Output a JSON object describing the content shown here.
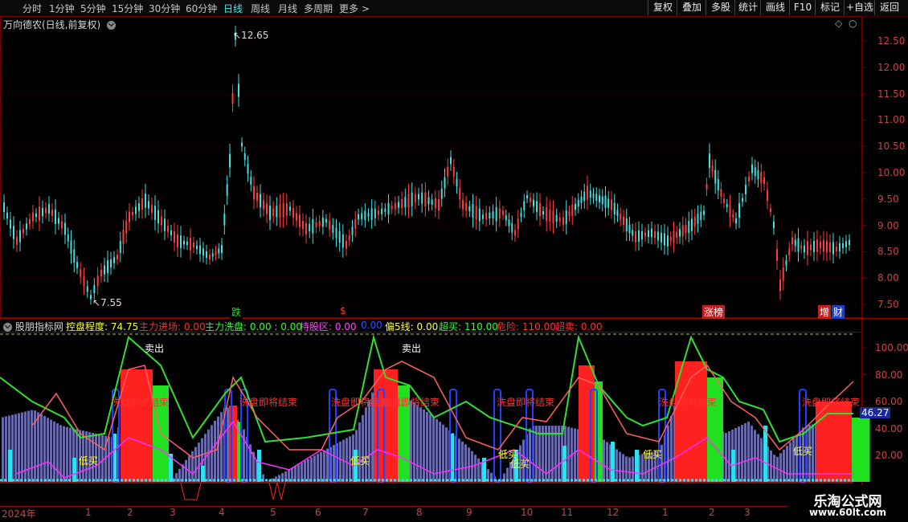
{
  "toolbar": {
    "timeframes": [
      "分时",
      "1分钟",
      "5分钟",
      "15分钟",
      "30分钟",
      "60分钟",
      "日线",
      "周线",
      "月线",
      "多周期",
      "更多 >"
    ],
    "active_timeframe": "日线",
    "right_buttons": [
      "复权",
      "叠加",
      "多股",
      "统计",
      "画线",
      "F10",
      "标记",
      "+自选",
      "返回"
    ]
  },
  "main_panel": {
    "title": "万向德农(日线,前复权)",
    "high_label": "12.65",
    "low_label": "7.55",
    "price_ticks": [
      "12.50",
      "12.00",
      "11.50",
      "11.00",
      "10.50",
      "10.00",
      "9.50",
      "9.00",
      "8.50",
      "8.00",
      "7.50"
    ],
    "event_tags": [
      {
        "text": "跌",
        "color": "#20e020",
        "bg": "#000"
      },
      {
        "text": "$",
        "color": "#ff3030",
        "bg": "#000"
      },
      {
        "text": "涨榜",
        "color": "#ffffff",
        "bg": "#c02020"
      },
      {
        "text": "增",
        "color": "#ffffff",
        "bg": "#c02020"
      },
      {
        "text": "财",
        "color": "#ffffff",
        "bg": "#2040c0"
      }
    ]
  },
  "indicator_panel": {
    "name": "股朋指标网",
    "items": [
      {
        "label": "控盘程度: 74.75",
        "color": "#ffff40"
      },
      {
        "label": "主力进场: 0.00",
        "color": "#ff3030"
      },
      {
        "label": "主力洗盘: 0.00 : 0.00",
        "color": "#30ff30"
      },
      {
        "label": "持股区: 0.00",
        "color": "#ff40ff"
      },
      {
        "label": "0.00",
        "color": "#3050ff"
      },
      {
        "label": "偏5线: 0.00",
        "color": "#ffff40"
      },
      {
        "label": "超买: 110.00",
        "color": "#30ff30"
      },
      {
        "label": "危险: 110.00",
        "color": "#ff3030"
      },
      {
        "label": "超卖: 0.00",
        "color": "#ff3030"
      }
    ],
    "ticks": [
      "100.00",
      "80.00",
      "60.00",
      "40.00",
      "20.00"
    ],
    "current_value": "46.27",
    "sell_labels": [
      "卖出",
      "卖出"
    ],
    "wash_labels": [
      "洗盘即将结束",
      "洗盘即将结束",
      "洗盘即将结束",
      "洗盘即将结束",
      "洗盘即将结束",
      "洗盘即将结束",
      "洗盘即将结束"
    ],
    "buy_labels": [
      "低买",
      "低买",
      "低买",
      "低买",
      "低买",
      "低买"
    ]
  },
  "date_axis": {
    "labels": [
      "2024年",
      "1",
      "2",
      "3",
      "4",
      "5",
      "6",
      "7",
      "8",
      "9",
      "10",
      "11",
      "12",
      "1",
      "2",
      "3"
    ]
  },
  "brand": {
    "name": "乐淘公式网",
    "url": "www.60lt.com"
  },
  "colors": {
    "up": "#ff3c3c",
    "down": "#40e0e0",
    "grid": "#7a0000",
    "axis": "#d04040"
  }
}
